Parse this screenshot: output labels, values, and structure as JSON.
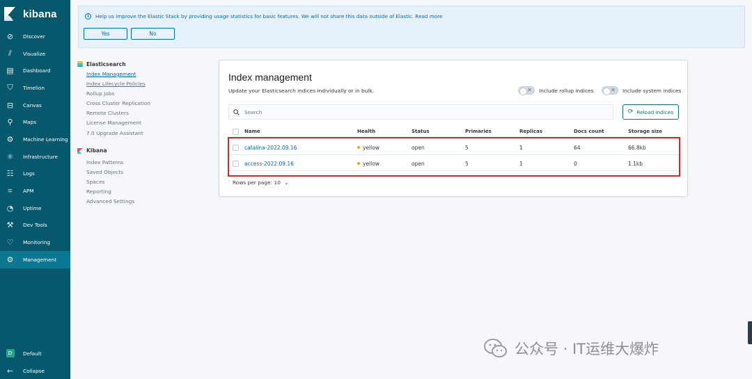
{
  "nav": {
    "brand": "kibana",
    "items": [
      {
        "label": "Discover",
        "icon": "compass-icon",
        "glyph": "⊘"
      },
      {
        "label": "Visualize",
        "icon": "chart-icon",
        "glyph": "⫽"
      },
      {
        "label": "Dashboard",
        "icon": "dashboard-icon",
        "glyph": "▤"
      },
      {
        "label": "Timelion",
        "icon": "shield-icon",
        "glyph": "⛉"
      },
      {
        "label": "Canvas",
        "icon": "briefcase-icon",
        "glyph": "⊟"
      },
      {
        "label": "Maps",
        "icon": "map-pin-icon",
        "glyph": "⚲"
      },
      {
        "label": "Machine Learning",
        "icon": "ml-icon",
        "glyph": "⚙"
      },
      {
        "label": "Infrastructure",
        "icon": "infra-icon",
        "glyph": "⚛"
      },
      {
        "label": "Logs",
        "icon": "logs-icon",
        "glyph": "☷"
      },
      {
        "label": "APM",
        "icon": "apm-icon",
        "glyph": "⌗"
      },
      {
        "label": "Uptime",
        "icon": "uptime-icon",
        "glyph": "◔"
      },
      {
        "label": "Dev Tools",
        "icon": "wrench-icon",
        "glyph": "⚒"
      },
      {
        "label": "Monitoring",
        "icon": "heart-monitor-icon",
        "glyph": "♡"
      },
      {
        "label": "Management",
        "icon": "gear-icon",
        "glyph": "⚙"
      }
    ],
    "space": {
      "badge": "D",
      "label": "Default"
    },
    "collapse": {
      "glyph": "←",
      "label": "Collapse"
    }
  },
  "banner": {
    "info_icon": "i",
    "text": "Help us improve the Elastic Stack by providing usage statistics for basic features. We will not share this data outside of Elastic. Read more",
    "yes": "Yes",
    "no": "No"
  },
  "sidemenu": {
    "elasticsearch_title": "Elasticsearch",
    "elasticsearch_items": [
      "Index Management",
      "Index Lifecycle Policies",
      "Rollup Jobs",
      "Cross Cluster Replication",
      "Remote Clusters",
      "License Management",
      "7.0 Upgrade Assistant"
    ],
    "kibana_title": "Kibana",
    "kibana_items": [
      "Index Patterns",
      "Saved Objects",
      "Spaces",
      "Reporting",
      "Advanced Settings"
    ]
  },
  "panel": {
    "title": "Index management",
    "subtitle": "Update your Elasticsearch indices individually or in bulk.",
    "toggle_rollup": "Include rollup indices",
    "toggle_system": "Include system indices",
    "search_placeholder": "Search",
    "reload": "Reload indices",
    "columns": [
      "Name",
      "Health",
      "Status",
      "Primaries",
      "Replicas",
      "Docs count",
      "Storage size"
    ],
    "rows": [
      {
        "name": "catalina-2022.09.16",
        "health": "yellow",
        "status": "open",
        "primaries": "5",
        "replicas": "1",
        "docs": "64",
        "size": "66.8kb"
      },
      {
        "name": "access-2022.09.16",
        "health": "yellow",
        "status": "open",
        "primaries": "5",
        "replicas": "1",
        "docs": "0",
        "size": "1.1kb"
      }
    ],
    "rows_per_page": "Rows per page: 10"
  },
  "watermark": "公众号 · IT运维大爆炸",
  "colors": {
    "nav_bg": "#07586d",
    "nav_active": "#0a7890",
    "link": "#006bb8",
    "accent_green": "#017d73",
    "health_yellow": "#f5a700",
    "highlight_red": "#e0202a"
  }
}
